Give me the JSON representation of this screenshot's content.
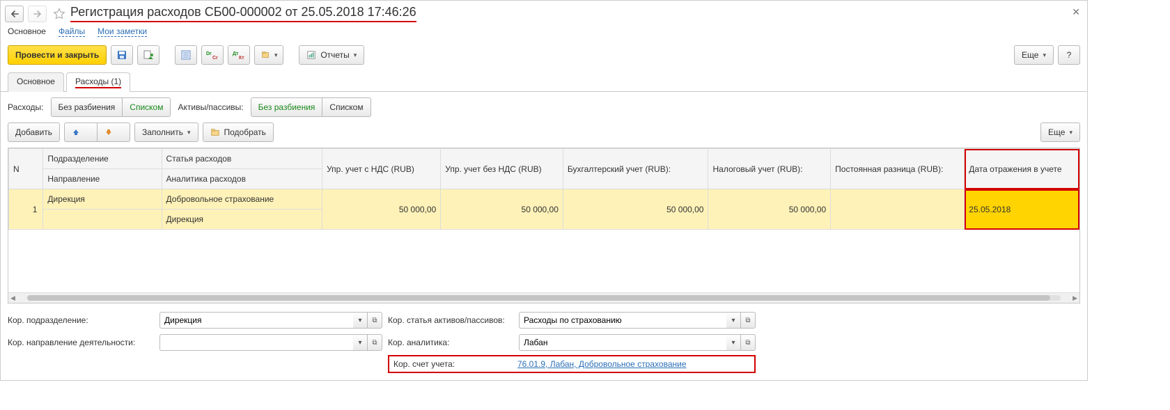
{
  "title": "Регистрация расходов СБ00-000002 от 25.05.2018 17:46:26",
  "subtabs": {
    "main": "Основное",
    "files": "Файлы",
    "notes": "Мои заметки"
  },
  "toolbar": {
    "post_close": "Провести и закрыть",
    "reports": "Отчеты",
    "more": "Еще",
    "help": "?"
  },
  "tabs2": {
    "main": "Основное",
    "expenses": "Расходы (1)"
  },
  "filter": {
    "expenses_label": "Расходы:",
    "no_split": "Без разбиения",
    "list": "Списком",
    "assets_label": "Активы/пассивы:"
  },
  "actions": {
    "add": "Добавить",
    "fill": "Заполнить",
    "pick": "Подобрать",
    "more": "Еще"
  },
  "table": {
    "h_n": "N",
    "h_sub": "Подразделение",
    "h_dir": "Направление",
    "h_art": "Статья расходов",
    "h_an": "Аналитика расходов",
    "h_m1": "Упр. учет с НДС (RUB)",
    "h_m2": "Упр. учет без НДС (RUB)",
    "h_m3": "Бухгалтерский учет (RUB):",
    "h_m4": "Налоговый учет (RUB):",
    "h_m5": "Постоянная разница (RUB):",
    "h_dt": "Дата отражения в учете",
    "rows": [
      {
        "n": "1",
        "sub": "Дирекция",
        "dir": "",
        "art": "Добровольное страхование",
        "an": "Дирекция",
        "m1": "50 000,00",
        "m2": "50 000,00",
        "m3": "50 000,00",
        "m4": "50 000,00",
        "m5": "",
        "dt": "25.05.2018"
      }
    ]
  },
  "form": {
    "l_sub": "Кор. подразделение:",
    "v_sub": "Дирекция",
    "l_dir": "Кор. направление деятельности:",
    "v_dir": "",
    "l_art": "Кор. статья активов/пассивов:",
    "v_art": "Расходы по страхованию",
    "l_an": "Кор. аналитика:",
    "v_an": "Лабан",
    "l_acc": "Кор. счет учета:",
    "v_acc": "76.01.9, Лабан, Добровольное страхование"
  },
  "glyph": {
    "caret": "▾",
    "open": "↗",
    "up": "⬆",
    "down": "⬇",
    "left": "◀",
    "right": "▶"
  }
}
